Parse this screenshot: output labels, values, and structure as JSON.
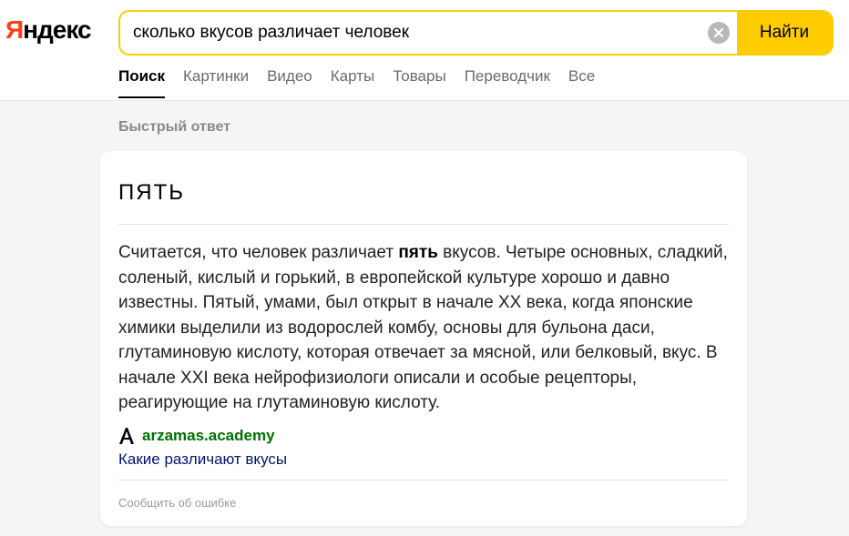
{
  "logo": {
    "first_letter": "Я",
    "rest": "ндекс"
  },
  "search": {
    "query": "сколько вкусов различает человек",
    "button_label": "Найти"
  },
  "tabs": [
    {
      "label": "Поиск",
      "active": true
    },
    {
      "label": "Картинки",
      "active": false
    },
    {
      "label": "Видео",
      "active": false
    },
    {
      "label": "Карты",
      "active": false
    },
    {
      "label": "Товары",
      "active": false
    },
    {
      "label": "Переводчик",
      "active": false
    },
    {
      "label": "Все",
      "active": false
    }
  ],
  "quick_answer": {
    "section_label": "Быстрый ответ",
    "title": "ПЯТЬ",
    "text_before": "Считается, что человек различает ",
    "text_bold": "пять",
    "text_after": " вкусов. Четыре основных, сладкий, соленый, кислый и горький, в европейской культуре хорошо и давно известны. Пятый, умами, был открыт в начале XX века, когда японские химики выделили из водорослей комбу, основы для бульона даси, глутаминовую кислоту, которая отвечает за мясной, или белковый, вкус. В начале XXI века нейрофизиологи описали и особые рецепторы, реагирующие на глутаминовую кислоту.",
    "source_domain": "arzamas.academy",
    "source_icon": "arzamas-logo-icon",
    "source_link": "Какие различают вкусы",
    "report_label": "Сообщить об ошибке"
  },
  "colors": {
    "accent": "#ffcc00",
    "logo_red": "#fc3f1d",
    "source_green": "#007000",
    "link_blue": "#04136b"
  }
}
